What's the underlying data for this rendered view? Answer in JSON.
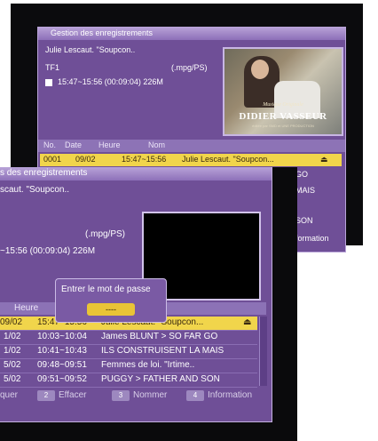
{
  "back": {
    "title": "Gestion des enregistrements",
    "program_name": "Julie Lescaut. \"Soupcon..",
    "channel": "TF1",
    "format": "(.mpg/PS)",
    "time_info": "15:47~15:56 (00:09:04) 226M",
    "thumbnail": {
      "caption_small": "Musique Originale",
      "caption_big": "DIDIER VASSEUR",
      "caption_tiny": "éditée par SMD et UNE PRODUCTION"
    },
    "columns": [
      "No.",
      "Date",
      "Heure",
      "Nom"
    ],
    "selected_row": {
      "no": "0001",
      "date": "09/02",
      "time": "15:47~15:56",
      "name": "Julie Lescaut. \"Soupcon...",
      "icon": "lock-icon"
    },
    "side_fragments": [
      "GO",
      "MAIS",
      "SON",
      "formation"
    ]
  },
  "front": {
    "title": "s des enregistrements",
    "program_name": "scaut. \"Soupcon..",
    "format": "(.mpg/PS)",
    "time_info": "~15:56 (00:09:04) 226M",
    "dialog": {
      "label": "Entrer le mot de passe",
      "value": "----"
    },
    "columns": {
      "time": "Heure"
    },
    "rows": [
      {
        "date": "09/02",
        "time": "15:47~15:56",
        "name": "Julie Lescaut. \"Soupcon...",
        "icon": "lock-icon"
      },
      {
        "date": "1/02",
        "time": "10:03~10:04",
        "name": "James BLUNT > SO FAR GO"
      },
      {
        "date": "1/02",
        "time": "10:41~10:43",
        "name": "ILS CONSTRUISENT LA MAIS"
      },
      {
        "date": "5/02",
        "time": "09:48~09:51",
        "name": "Femmes de loi. \"Irtime.."
      },
      {
        "date": "5/02",
        "time": "09:51~09:52",
        "name": "PUGGY > FATHER AND SON"
      }
    ],
    "footer": {
      "label1": "quer",
      "key2": "2",
      "label2": "Effacer",
      "key3": "3",
      "label3": "Nommer",
      "key4": "4",
      "label4": "Information"
    }
  },
  "colors": {
    "panel": "#6f4f97",
    "highlight": "#f1d54b",
    "title_bar": "#b8a3d8"
  }
}
